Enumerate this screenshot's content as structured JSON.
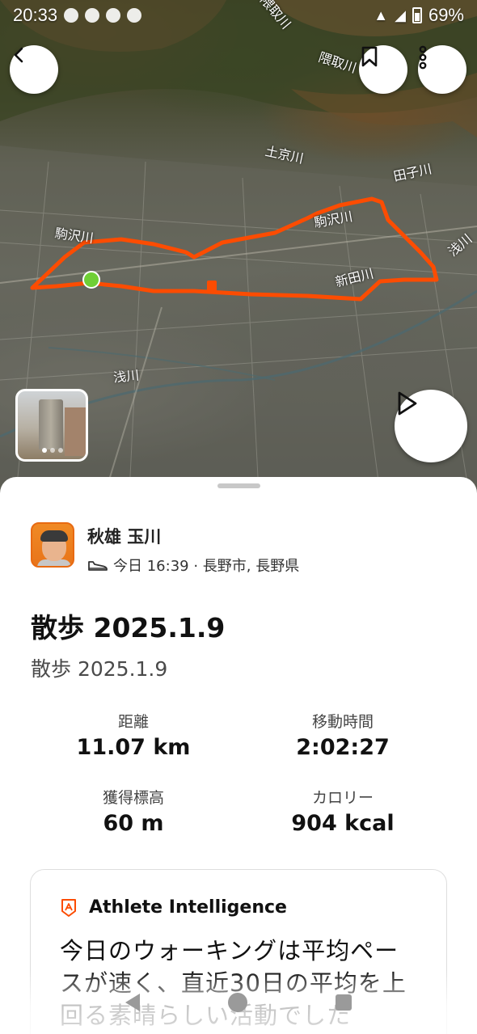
{
  "status_bar": {
    "time": "20:33",
    "battery": "69%"
  },
  "map": {
    "labels": [
      {
        "key": "r1",
        "text": "隈取川"
      },
      {
        "key": "r2",
        "text": "隈取川"
      },
      {
        "key": "r3",
        "text": "土京川"
      },
      {
        "key": "r4",
        "text": "田子川"
      },
      {
        "key": "r5",
        "text": "駒沢川"
      },
      {
        "key": "r6",
        "text": "駒沢川"
      },
      {
        "key": "r7",
        "text": "新田川"
      },
      {
        "key": "r8",
        "text": "浅川"
      },
      {
        "key": "r9",
        "text": "浅川"
      }
    ],
    "route_color": "#fc4c02",
    "start_color": "#6fcf35"
  },
  "athlete": {
    "name": "秋雄 玉川",
    "meta": "今日 16:39 · 長野市, 長野県"
  },
  "activity": {
    "title": "散歩 2025.1.9",
    "description": "散歩 2025.1.9"
  },
  "stats": [
    {
      "label": "距離",
      "value": "11.07 km"
    },
    {
      "label": "移動時間",
      "value": "2:02:27"
    },
    {
      "label": "獲得標高",
      "value": "60 m"
    },
    {
      "label": "カロリー",
      "value": "904 kcal"
    }
  ],
  "ai_card": {
    "title": "Athlete Intelligence",
    "text": "今日のウォーキングは平均ペースが速く、直近30日の平均を上回る素晴らしい活動でした"
  },
  "colors": {
    "accent": "#fc4c02"
  }
}
